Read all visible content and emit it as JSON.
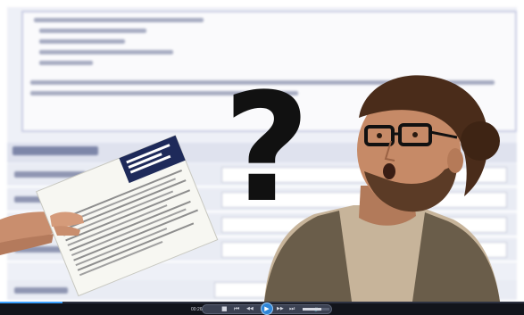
{
  "player": {
    "time": "00:26",
    "progress_fraction": 0.12,
    "volume_fraction": 0.7,
    "controls": [
      {
        "name": "stop-icon",
        "glyph": "■"
      },
      {
        "name": "previous-icon",
        "glyph": "⏮"
      },
      {
        "name": "rewind-icon",
        "glyph": "◀◀"
      },
      {
        "name": "play-icon",
        "glyph": "▶"
      },
      {
        "name": "fast-forward-icon",
        "glyph": "▶▶"
      },
      {
        "name": "next-icon",
        "glyph": "⏭"
      },
      {
        "name": "mute-icon",
        "glyph": "🔈"
      }
    ]
  },
  "overlay": {
    "question_mark": "?"
  },
  "colors": {
    "accent": "#2f86d8",
    "player_bg": "#12141b",
    "form_bg": "#eef0f7"
  }
}
